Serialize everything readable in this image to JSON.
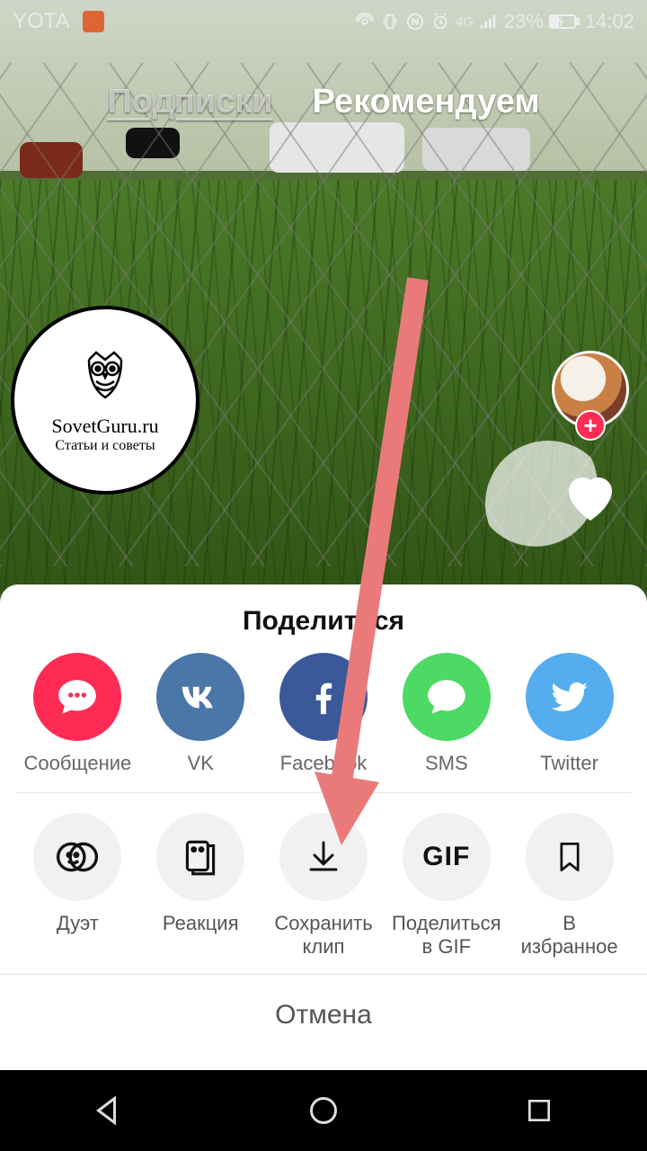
{
  "statusbar": {
    "carrier": "YOTA",
    "battery": "23%",
    "time": "14:02",
    "network": "4G"
  },
  "feed": {
    "tab_following": "Подписки",
    "tab_for_you": "Рекомендуем"
  },
  "watermark": {
    "title": "SovetGuru.ru",
    "subtitle": "Статьи и советы"
  },
  "rail": {
    "follow_plus": "+"
  },
  "sheet": {
    "title": "Поделиться",
    "share": {
      "message": "Сообщение",
      "vk": "VK",
      "facebook": "Facebook",
      "sms": "SMS",
      "twitter": "Twitter"
    },
    "actions": {
      "duet": "Дуэт",
      "reaction": "Реакция",
      "save": "Сохранить\nклип",
      "share_gif": "Поделиться\nв GIF",
      "favorite": "В\nизбранное",
      "gif_text": "GIF"
    },
    "cancel": "Отмена"
  }
}
